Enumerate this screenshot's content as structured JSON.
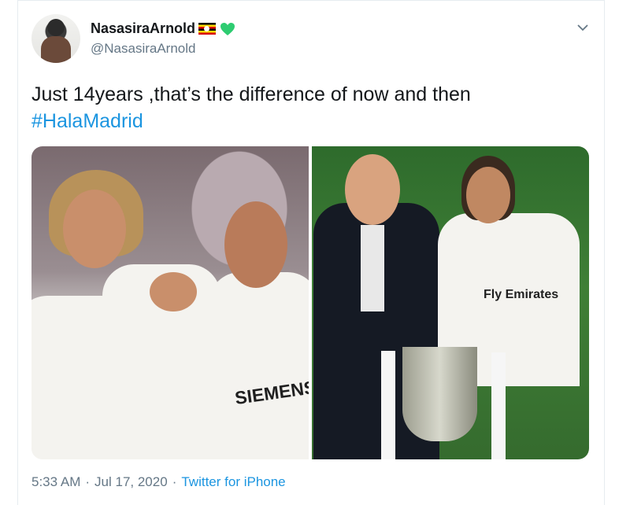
{
  "tweet": {
    "display_name": "NasasiraArnold",
    "handle": "@NasasiraArnold",
    "text": "Just 14years ,that’s the difference of now and then",
    "hashtag": "#HalaMadrid",
    "time": "5:33 AM",
    "separator": "·",
    "date": "Jul 17, 2020",
    "source": "Twitter for iPhone",
    "badges": [
      "uganda-flag-icon",
      "green-heart-icon"
    ]
  },
  "media": {
    "left_photo": {
      "sponsor_text": "SIEMENS"
    },
    "right_photo": {
      "sponsor_text": "Fly Emirates"
    }
  },
  "colors": {
    "link": "#1b95e0",
    "secondary_text": "#657786",
    "heart": "#2ecc71"
  }
}
